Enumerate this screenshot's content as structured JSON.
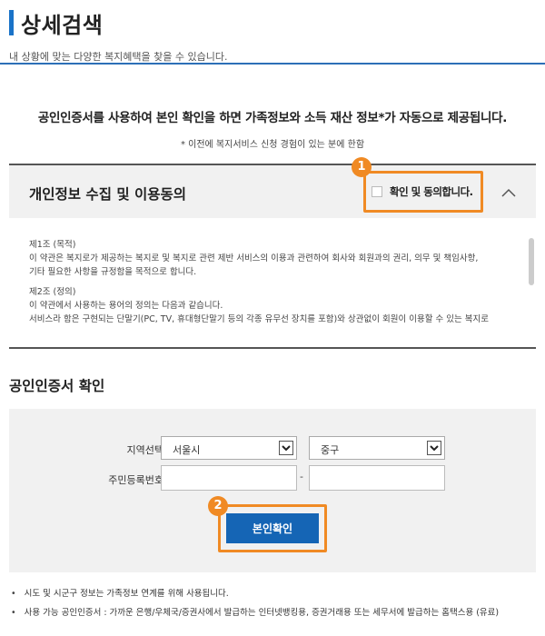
{
  "header": {
    "title": "상세검색",
    "subtitle": "내 상황에 맞는 다양한 복지혜택을 찾을 수 있습니다."
  },
  "notice": {
    "main": "공인인증서를 사용하여 본인 확인을 하면 가족정보와 소득 재산 정보*가 자동으로 제공됩니다.",
    "sub": "* 이전에 복지서비스 신청 경험이 있는 분에 한함"
  },
  "consent": {
    "title": "개인정보 수집 및 이용동의",
    "agree_label": "확인 및 동의합니다.",
    "agree_checked": false,
    "badge": "1"
  },
  "terms": {
    "lines": [
      "제1조 (목적)",
      "이 약관은 복지로가 제공하는 복지로 및 복지로 관련 제반 서비스의 이용과 관련하여 회사와 회원과의 권리, 의무 및 책임사항,",
      "기타 필요한 사항을 규정함을 목적으로 합니다.",
      "제2조 (정의)",
      "이 약관에서 사용하는 용어의 정의는 다음과 같습니다.",
      "서비스라 함은 구현되는 단말기(PC, TV, 휴대형단말기 등의 각종 유무선 장치를 포함)와 상관없이 회원이 이용할 수 있는 복지로"
    ]
  },
  "cert": {
    "title": "공인인증서 확인",
    "region_label": "지역선택",
    "city_value": "서울시",
    "district_value": "중구",
    "resident_label": "주민등록번호",
    "dash": "-",
    "confirm_label": "본인확인",
    "badge": "2"
  },
  "notes": [
    "시도 및 시군구 정보는 가족정보 연계를 위해 사용됩니다.",
    "사용 가능 공인인증서 : 가까운 은행/우체국/증권사에서 발급하는 인터넷뱅킹용, 증권거래용 또는 세무서에 발급하는 홈택스용 (유료)"
  ],
  "colors": {
    "accent": "#1a73c8",
    "button": "#1565b5",
    "highlight": "#f08a24"
  }
}
